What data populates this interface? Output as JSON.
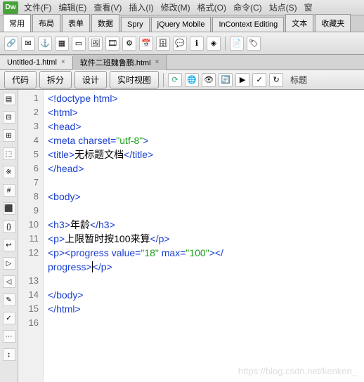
{
  "logo": "Dw",
  "menu": [
    "文件(F)",
    "编辑(E)",
    "查看(V)",
    "插入(I)",
    "修改(M)",
    "格式(O)",
    "命令(C)",
    "站点(S)",
    "窗"
  ],
  "insertTabs": [
    "常用",
    "布局",
    "表单",
    "数据",
    "Spry",
    "jQuery Mobile",
    "InContext Editing",
    "文本",
    "收藏夹"
  ],
  "activeInsertTab": "常用",
  "fileTabs": [
    {
      "name": "Untitled-1.html",
      "active": true
    },
    {
      "name": "软件二班魏鲁鹏.html",
      "active": false
    }
  ],
  "viewButtons": [
    "代码",
    "拆分",
    "设计",
    "实时视图"
  ],
  "rightLabel": "标题",
  "lines": [
    1,
    2,
    3,
    4,
    5,
    6,
    7,
    8,
    9,
    10,
    11,
    12,
    13,
    14,
    15,
    16
  ],
  "code": {
    "l1": {
      "doctype": "<!doctype html>"
    },
    "l2": {
      "open": "<html>"
    },
    "l3": {
      "open": "<head>"
    },
    "l4": {
      "tag": "<meta ",
      "attr": "charset=",
      "val": "\"utf-8\"",
      "end": ">"
    },
    "l5": {
      "open": "<title>",
      "text": "无标题文档",
      "close": "</title>"
    },
    "l6": {
      "close": "</head>"
    },
    "l8": {
      "open": "<body>"
    },
    "l10": {
      "open": "<h3>",
      "text": "年龄",
      "close": "</h3>"
    },
    "l11": {
      "open": "<p>",
      "text": "上限暂时按100来算",
      "close": "</p>"
    },
    "l12a": {
      "popen": "<p>",
      "tag": "<progress ",
      "attr1": "value=",
      "val1": "\"18\"",
      "attr2": " max=",
      "val2": "\"100\"",
      "end": "></"
    },
    "l12b": {
      "cont": "progress>",
      "pclose": "</p>"
    },
    "l14": {
      "close": "</body>"
    },
    "l15": {
      "close": "</html>"
    }
  },
  "watermark": "https://blog.csdn.net/kenken_"
}
